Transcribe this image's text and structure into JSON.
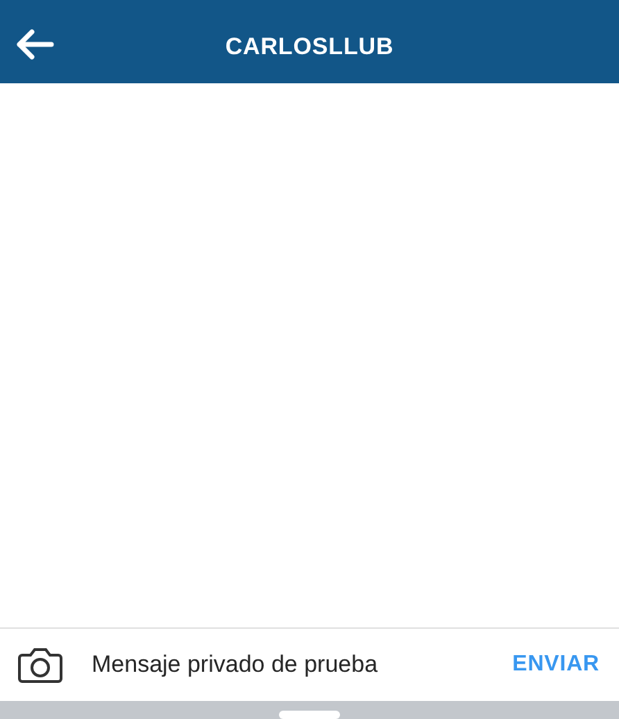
{
  "header": {
    "title": "CARLOSLLUB"
  },
  "composer": {
    "value": "Mensaje privado de prueba",
    "send": "ENVIAR"
  }
}
